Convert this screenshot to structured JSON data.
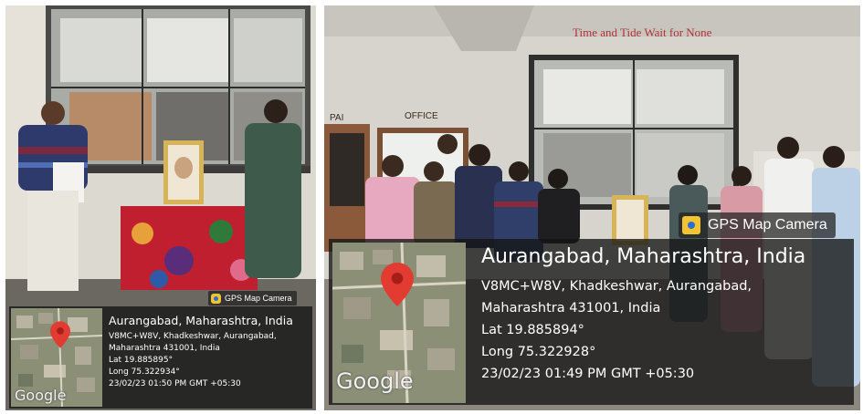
{
  "photos": [
    {
      "id": "left",
      "gps_tag": "GPS Map Camera",
      "location": "Aurangabad, Maharashtra, India",
      "address_line1": "V8MC+W8V, Khadkeshwar, Aurangabad,",
      "address_line2": "Maharashtra 431001, India",
      "lat": "Lat 19.885895°",
      "long": "Long 75.322934°",
      "datetime": "23/02/23 01:50 PM GMT +05:30",
      "map_logo": "Google"
    },
    {
      "id": "right",
      "gps_tag": "GPS Map Camera",
      "location": "Aurangabad, Maharashtra, India",
      "address_line1": "V8MC+W8V, Khadkeshwar, Aurangabad,",
      "address_line2": "Maharashtra 431001, India",
      "lat": "Lat 19.885894°",
      "long": "Long 75.322928°",
      "datetime": "23/02/23 01:49 PM GMT +05:30",
      "map_logo": "Google",
      "wall_sign": "Time and Tide Wait for None",
      "door_sign_office": "OFFICE",
      "door_sign_left": "PAI"
    }
  ],
  "colors": {
    "map_pin": "#e23b32",
    "overlay_bg": "#1e1e1e",
    "camera_icon": "#f4c430"
  },
  "icons": [
    "camera-app-icon",
    "map-pin-icon"
  ]
}
